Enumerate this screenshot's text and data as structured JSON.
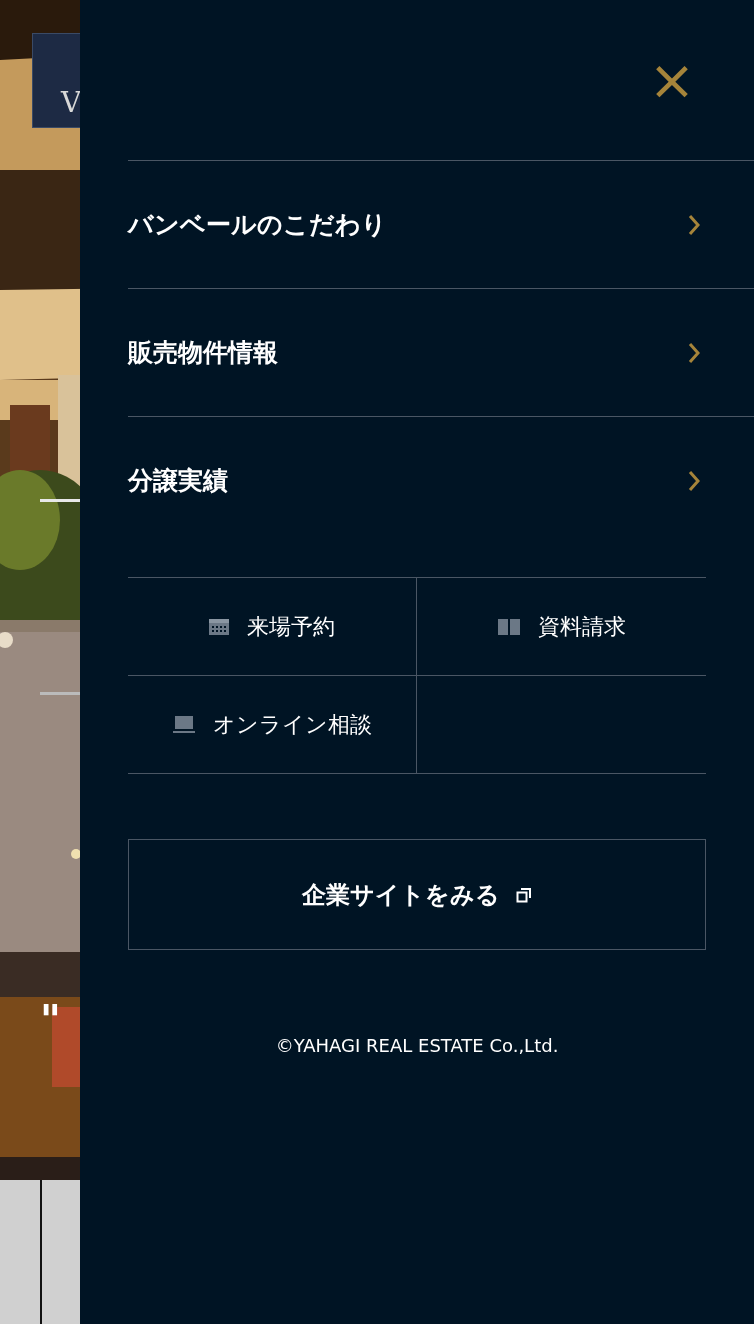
{
  "background_page": {
    "logo_text": "V",
    "headline_fragment": "\""
  },
  "menu": {
    "close": "×",
    "items": [
      {
        "label": "バンベールのこだわり"
      },
      {
        "label": "販売物件情報"
      },
      {
        "label": "分譲実績"
      }
    ],
    "actions": [
      {
        "kind": "calendar",
        "label": "来場予約"
      },
      {
        "kind": "book",
        "label": "資料請求"
      },
      {
        "kind": "laptop",
        "label": "オンライン相談"
      }
    ],
    "corporate_link": {
      "label": "企業サイトをみる"
    },
    "copyright": "©YAHAGI REAL ESTATE Co.,Ltd."
  }
}
